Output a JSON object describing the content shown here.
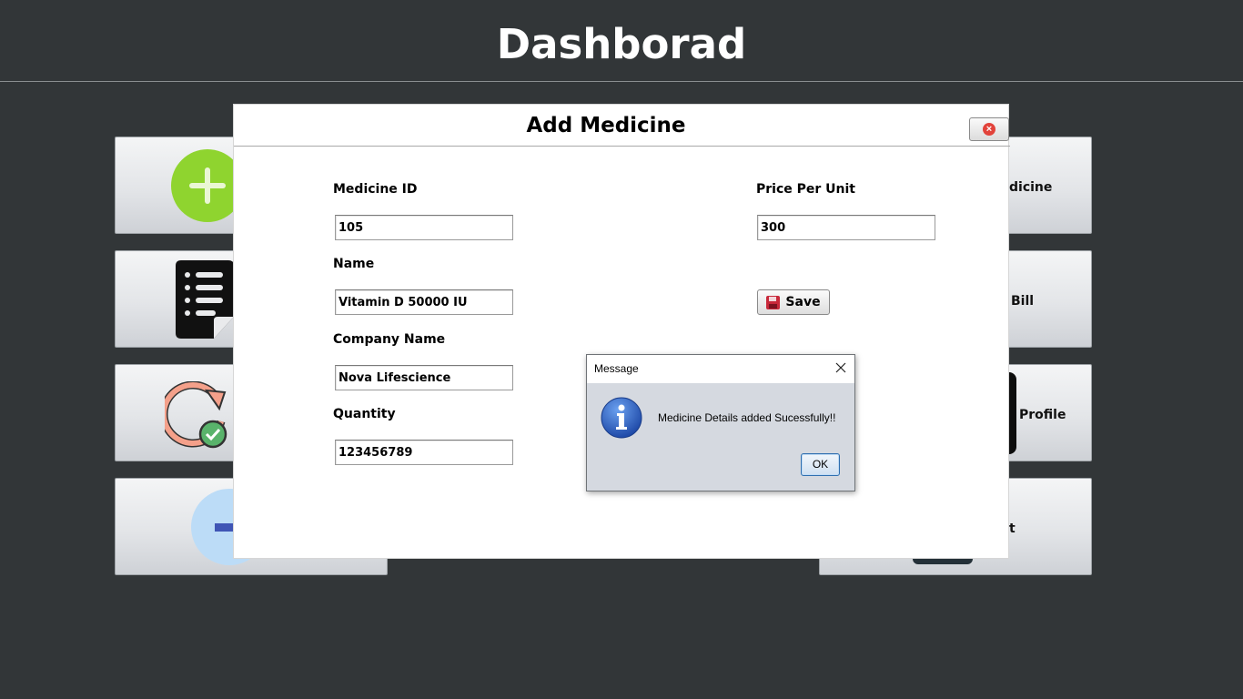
{
  "dashboard": {
    "title": "Dashborad",
    "tiles_right": {
      "top_label": "dicine",
      "second_label": "Bill",
      "third_label": "Profile",
      "fourth_label": "t"
    }
  },
  "add_medicine": {
    "title": "Add Medicine",
    "labels": {
      "medicine_id": "Medicine ID",
      "name": "Name",
      "company_name": "Company Name",
      "quantity": "Quantity",
      "price_per_unit": "Price Per Unit"
    },
    "values": {
      "medicine_id": "105",
      "name": "Vitamin D 50000 IU",
      "company_name": "Nova Lifescience",
      "quantity": "123456789",
      "price_per_unit": "300"
    },
    "save_label": "Save"
  },
  "message_dialog": {
    "title": "Message",
    "text": "Medicine Details added Sucessfully!!",
    "ok_label": "OK"
  },
  "colors": {
    "background": "#323638",
    "add_icon_green": "#8fd42f",
    "close_red": "#e2433b",
    "info_blue": "#2456b3"
  },
  "icons": [
    "plus-circle-icon",
    "list-document-icon",
    "refresh-check-icon",
    "minus-circle-icon",
    "close-circle-icon",
    "floppy-disk-icon",
    "info-icon",
    "close-x-icon"
  ]
}
